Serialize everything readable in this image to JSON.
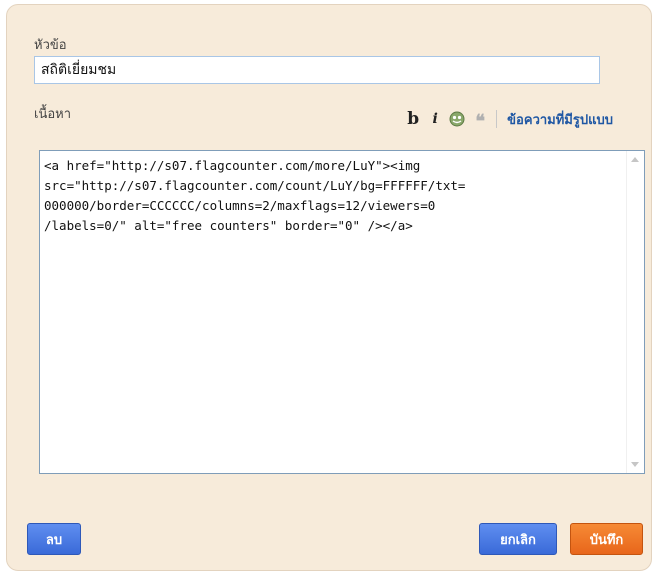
{
  "form": {
    "title_label": "หัวข้อ",
    "title_value": "สถิติเยี่ยมชม",
    "content_label": "เนื้อหา"
  },
  "toolbar": {
    "bold_label": "b",
    "italic_label": "i",
    "quote_label": "❝",
    "rich_text_link": "ข้อความที่มีรูปแบบ"
  },
  "editor": {
    "content": "<a href=\"http://s07.flagcounter.com/more/LuY\"><img\nsrc=\"http://s07.flagcounter.com/count/LuY/bg=FFFFFF/txt=\n000000/border=CCCCCC/columns=2/maxflags=12/viewers=0\n/labels=0/\" alt=\"free counters\" border=\"0\" /></a>"
  },
  "actions": {
    "delete_label": "ลบ",
    "cancel_label": "ยกเลิก",
    "save_label": "บันทึก"
  },
  "colors": {
    "background": "#f7ebda",
    "blue_button": "#3a6ad8",
    "orange_button": "#e8661b",
    "link": "#1f57a4"
  },
  "icons": {
    "bold": "bold-icon",
    "italic": "italic-icon",
    "image": "image-insert-icon",
    "quote": "blockquote-icon"
  }
}
